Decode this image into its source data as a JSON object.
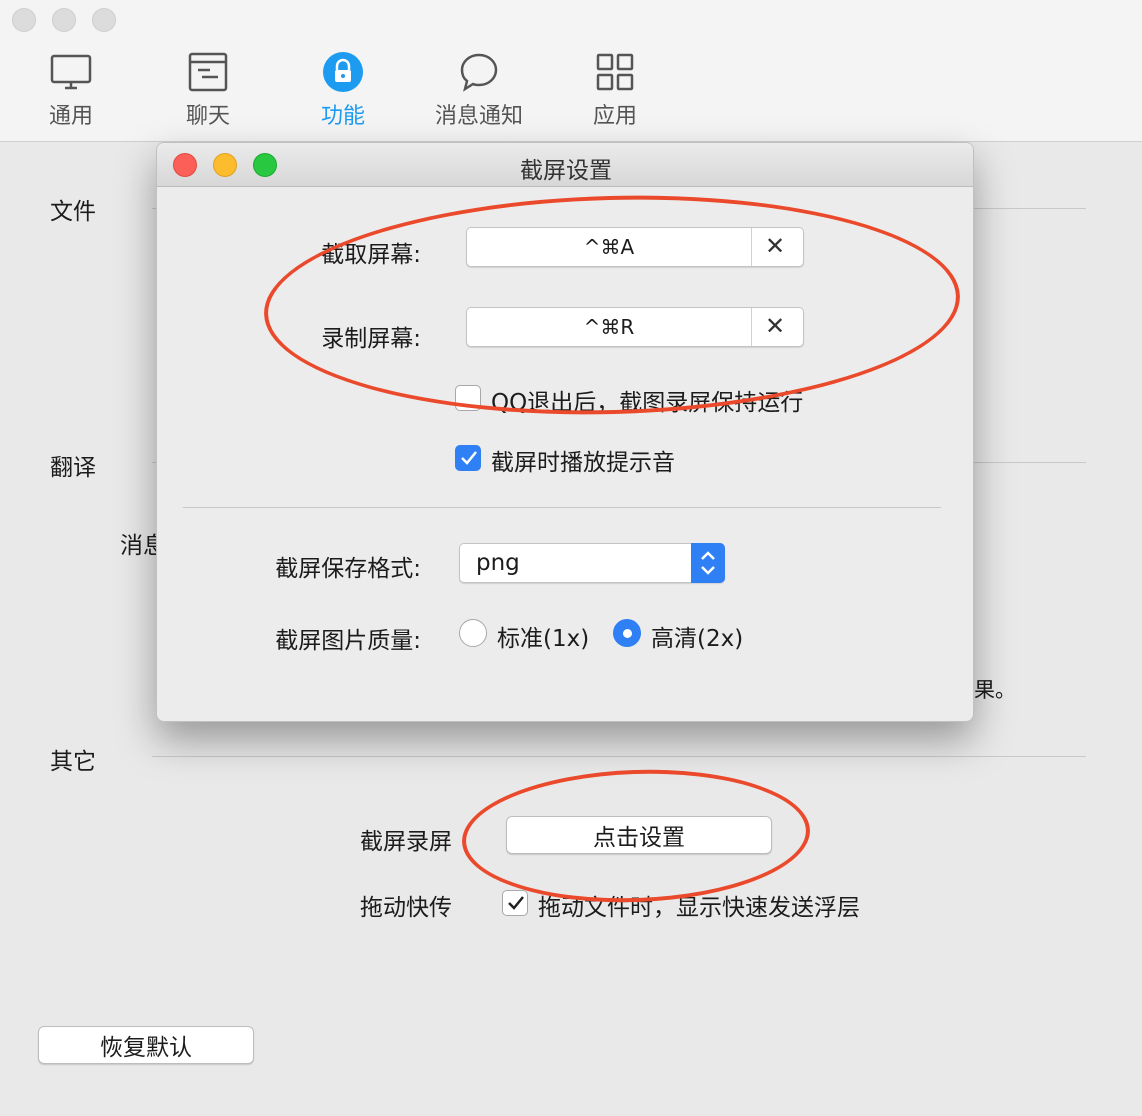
{
  "toolbar": {
    "tabs": [
      {
        "label": "通用",
        "icon": "monitor-icon"
      },
      {
        "label": "聊天",
        "icon": "chat-window-icon"
      },
      {
        "label": "功能",
        "icon": "lock-circle-icon",
        "active": true
      },
      {
        "label": "消息通知",
        "icon": "speech-bubble-icon"
      },
      {
        "label": "应用",
        "icon": "grid-icon"
      }
    ]
  },
  "main": {
    "sections": {
      "file": "文件",
      "translate": "翻译",
      "translate_partial": "消息",
      "other": "其它"
    },
    "partial_text": "果。",
    "screenshot_row": {
      "label": "截屏录屏",
      "button": "点击设置"
    },
    "drag_row": {
      "label": "拖动快传",
      "checkbox_label": "拖动文件时，显示快速发送浮层",
      "checked": true
    },
    "restore_button": "恢复默认"
  },
  "dialog": {
    "title": "截屏设置",
    "capture_screen": {
      "label": "截取屏幕:",
      "shortcut": "^⌘A"
    },
    "record_screen": {
      "label": "录制屏幕:",
      "shortcut": "^⌘R"
    },
    "keep_running": {
      "label": "QQ退出后，截图录屏保持运行",
      "checked": false
    },
    "play_sound": {
      "label": "截屏时播放提示音",
      "checked": true
    },
    "save_format": {
      "label": "截屏保存格式:",
      "value": "png"
    },
    "quality": {
      "label": "截屏图片质量:",
      "options": [
        {
          "label": "标准(1x)",
          "selected": false
        },
        {
          "label": "高清(2x)",
          "selected": true
        }
      ]
    }
  },
  "colors": {
    "accent": "#2f7ff5",
    "active_tab": "#1d9bf0",
    "annotation": "#ea4a2b",
    "close": "#fc5f57",
    "minimize": "#fdbc2e",
    "zoom": "#28c840"
  }
}
